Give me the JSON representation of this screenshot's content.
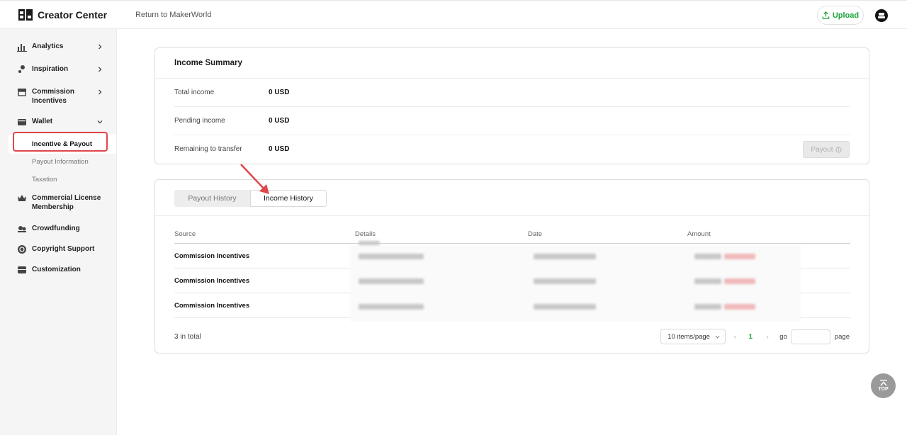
{
  "header": {
    "app_title": "Creator Center",
    "return_link": "Return to MakerWorld",
    "upload_label": "Upload",
    "accent_color": "#1aa33a"
  },
  "sidebar": {
    "items": [
      {
        "label": "Analytics",
        "icon": "bar-chart-icon"
      },
      {
        "label": "Inspiration",
        "icon": "bulb-icon"
      },
      {
        "label": "Commission Incentives",
        "icon": "store-icon"
      },
      {
        "label": "Wallet",
        "icon": "wallet-icon"
      },
      {
        "label": "Commercial License Membership",
        "icon": "crown-icon"
      },
      {
        "label": "Crowdfunding",
        "icon": "crowdfunding-icon"
      },
      {
        "label": "Copyright Support",
        "icon": "copyright-icon"
      },
      {
        "label": "Customization",
        "icon": "customization-icon"
      }
    ],
    "wallet_sub": [
      "Incentive & Payout",
      "Payout Information",
      "Taxation"
    ]
  },
  "summary": {
    "title": "Income Summary",
    "rows": [
      {
        "label": "Total income",
        "value": "0 USD"
      },
      {
        "label": "Pending income",
        "value": "0 USD"
      },
      {
        "label": "Remaining to transfer",
        "value": "0 USD"
      }
    ],
    "payout_label": "Payout"
  },
  "history": {
    "tabs": [
      "Payout History",
      "Income History"
    ],
    "active_tab": "Income History",
    "columns": [
      "Source",
      "Details",
      "Date",
      "Amount"
    ],
    "rows": [
      {
        "source": "Commission Incentives"
      },
      {
        "source": "Commission Incentives"
      },
      {
        "source": "Commission Incentives"
      }
    ],
    "total_text": "3 in total",
    "page_size": "10 items/page",
    "current_page": "1",
    "go_label": "go",
    "page_label": "page"
  },
  "top_button": {
    "label": "TOP"
  },
  "colors": {
    "highlight": "#e0464a",
    "accent": "#1aa33a"
  }
}
